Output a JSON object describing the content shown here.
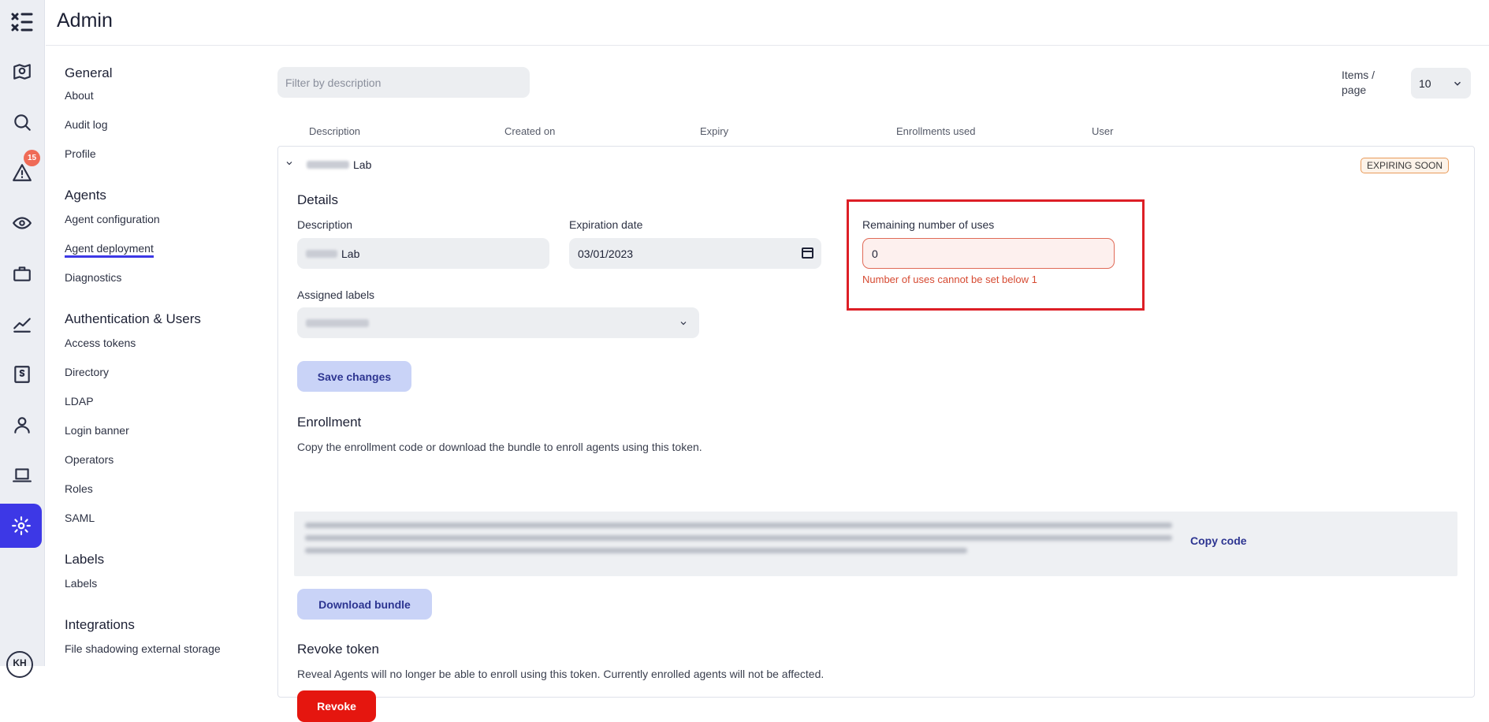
{
  "header": {
    "title": "Admin"
  },
  "rail": {
    "logo": "logo-mark",
    "icons": [
      "map-icon",
      "search-icon",
      "alert-icon",
      "eye-icon",
      "briefcase-icon",
      "chart-icon",
      "legal-icon",
      "user-icon",
      "laptop-icon",
      "gear-icon"
    ],
    "alert_count": "15",
    "avatar": "KH",
    "accent": "#3d38e6"
  },
  "nav": {
    "sections": [
      {
        "label": "General",
        "items": [
          "About",
          "Audit log",
          "Profile"
        ]
      },
      {
        "label": "Agents",
        "items": [
          "Agent configuration",
          "Agent deployment",
          "Diagnostics"
        ]
      },
      {
        "label": "Authentication & Users",
        "items": [
          "Access tokens",
          "Directory",
          "LDAP",
          "Login banner",
          "Operators",
          "Roles",
          "SAML"
        ]
      },
      {
        "label": "Labels",
        "items": [
          "Labels"
        ]
      },
      {
        "label": "Integrations",
        "items": [
          "File shadowing external storage"
        ]
      }
    ],
    "current": "Agent deployment"
  },
  "toolbar": {
    "filter_placeholder": "Filter by description",
    "items_per_page_label": "Items / page",
    "items_per_page_value": "10"
  },
  "table": {
    "columns": [
      "Description",
      "Created on",
      "Expiry",
      "Enrollments used",
      "User"
    ]
  },
  "token": {
    "title_suffix": "Lab",
    "status_tag": "EXPIRING SOON",
    "details_heading": "Details",
    "description_label": "Description",
    "description_value": "Lab",
    "expiration_label": "Expiration date",
    "expiration_value": "03/01/2023",
    "uses_label": "Remaining number of uses",
    "uses_value": "0",
    "uses_error": "Number of uses cannot be set below 1",
    "labels_label": "Assigned labels",
    "save_label": "Save changes",
    "enrollment_heading": "Enrollment",
    "enrollment_text": "Copy the enrollment code or download the bundle to enroll agents using this token.",
    "copy_label": "Copy code",
    "download_label": "Download bundle",
    "revoke_heading": "Revoke token",
    "revoke_text": "Reveal Agents will no longer be able to enroll using this token. Currently enrolled agents will not be affected.",
    "revoke_label": "Revoke"
  }
}
